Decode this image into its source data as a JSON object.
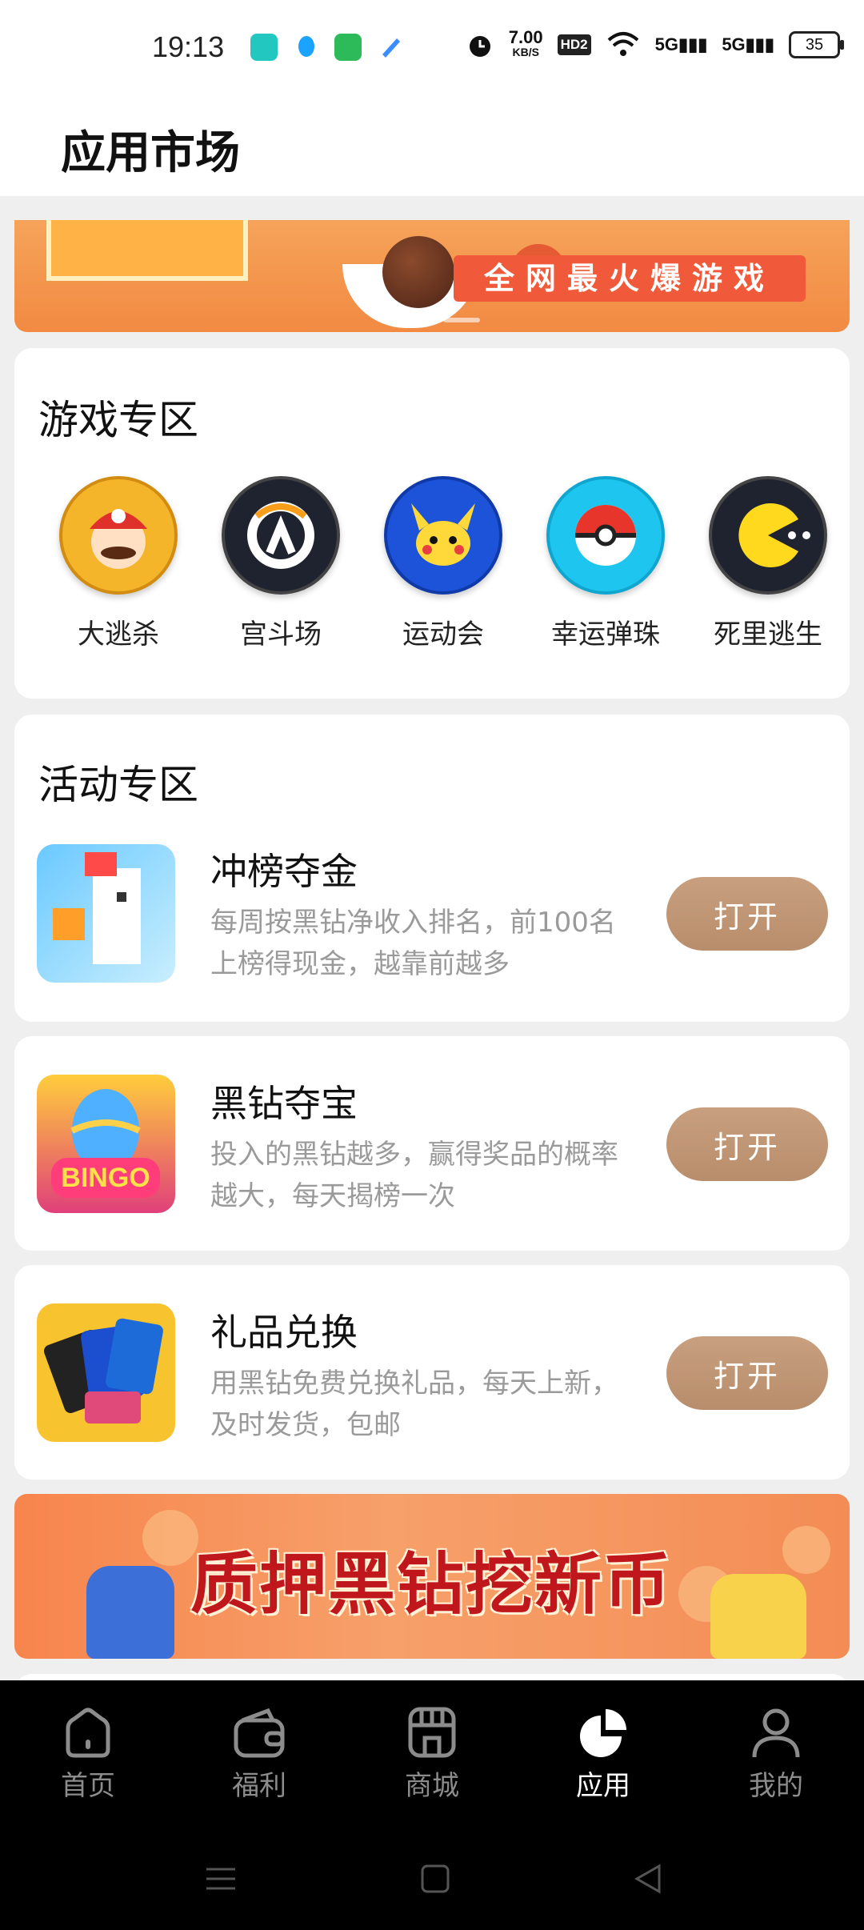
{
  "status_bar": {
    "time": "19:13",
    "net_speed_value": "7.00",
    "net_speed_unit": "KB/S",
    "hd_badge": "HD2",
    "signal1": "5G",
    "signal2": "5G",
    "battery": "35"
  },
  "header": {
    "title": "应用市场"
  },
  "top_banner": {
    "text": "全网最火爆游戏"
  },
  "games_section": {
    "title": "游戏专区",
    "items": [
      {
        "name": "大逃杀",
        "icon": "mario-icon",
        "color": "#f5b52a"
      },
      {
        "name": "宫斗场",
        "icon": "overwatch-icon",
        "color": "#1f2330"
      },
      {
        "name": "运动会",
        "icon": "pikachu-icon",
        "color": "#1c53d9"
      },
      {
        "name": "幸运弹珠",
        "icon": "pokeball-icon",
        "color": "#1ec6ef"
      },
      {
        "name": "死里逃生",
        "icon": "pacman-icon",
        "color": "#1f2330"
      }
    ]
  },
  "activity_section": {
    "title": "活动专区",
    "items": [
      {
        "title": "冲榜夺金",
        "desc": "每周按黑钻净收入排名，前100名上榜得现金，越靠前越多",
        "button": "打开",
        "icon": "crossy-chicken-icon"
      },
      {
        "title": "黑钻夺宝",
        "desc": "投入的黑钻越多，赢得奖品的概率越大，每天揭榜一次",
        "button": "打开",
        "icon": "bingo-pop-icon"
      },
      {
        "title": "礼品兑换",
        "desc": "用黑钻免费兑换礼品，每天上新，及时发货，包邮",
        "button": "打开",
        "icon": "gift-cards-icon"
      }
    ]
  },
  "bottom_banner": {
    "text": "质押黑钻挖新币"
  },
  "bottom_nav": {
    "items": [
      {
        "label": "首页",
        "icon": "home-icon",
        "active": false
      },
      {
        "label": "福利",
        "icon": "wallet-icon",
        "active": false
      },
      {
        "label": "商城",
        "icon": "store-icon",
        "active": false
      },
      {
        "label": "应用",
        "icon": "pie-chart-icon",
        "active": true
      },
      {
        "label": "我的",
        "icon": "profile-icon",
        "active": false
      }
    ]
  },
  "colors": {
    "button": "#c29a79",
    "accent_orange": "#f28a42"
  }
}
